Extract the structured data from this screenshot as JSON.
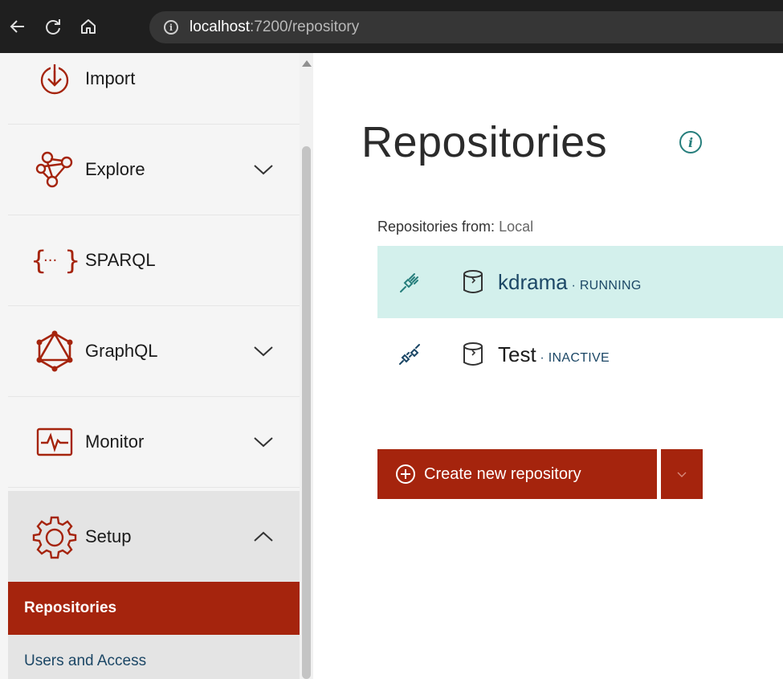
{
  "browser": {
    "url_host": "localhost",
    "url_rest": ":7200/repository"
  },
  "sidebar": {
    "items": [
      {
        "label": "Import",
        "icon": "import-icon",
        "expandable": false
      },
      {
        "label": "Explore",
        "icon": "explore-icon",
        "expandable": true
      },
      {
        "label": "SPARQL",
        "icon": "sparql-icon",
        "expandable": false
      },
      {
        "label": "GraphQL",
        "icon": "graphql-icon",
        "expandable": true
      },
      {
        "label": "Monitor",
        "icon": "monitor-icon",
        "expandable": true
      },
      {
        "label": "Setup",
        "icon": "gear-icon",
        "expandable": true,
        "expanded": true
      }
    ],
    "subitems": [
      {
        "label": "Repositories",
        "selected": true
      },
      {
        "label": "Users and Access",
        "selected": false
      }
    ]
  },
  "main": {
    "title": "Repositories",
    "repos_from_label": "Repositories from:",
    "repos_from_value": "Local",
    "repos": [
      {
        "name": "kdrama",
        "status": " · RUNNING",
        "connected": true
      },
      {
        "name": "Test",
        "status": " · INACTIVE",
        "connected": false
      }
    ],
    "create_label": "Create new repository"
  },
  "colors": {
    "brand": "#a5240d",
    "teal": "#267e7c",
    "active_row": "#d3f0ec",
    "link": "#1c4766"
  }
}
